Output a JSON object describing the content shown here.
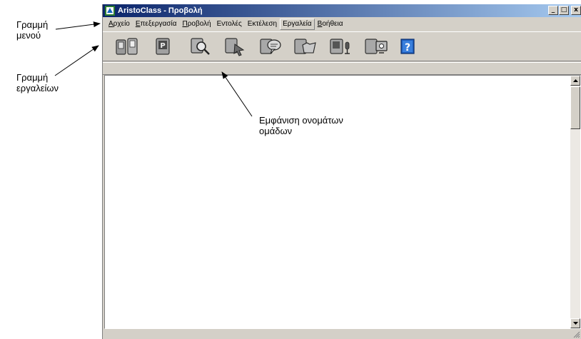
{
  "window": {
    "title": "AristoClass - Προβολή",
    "controls": [
      "_",
      "□",
      "x"
    ]
  },
  "menu": [
    {
      "label": "Αρχείο",
      "mnemonic": "Α",
      "rest": "ρχείο"
    },
    {
      "label": "Επεξεργασία",
      "mnemonic": "Ε",
      "rest": "πεξεργασία"
    },
    {
      "label": "Προβολή",
      "mnemonic": "Π",
      "rest": "ροβολή"
    },
    {
      "label": "Εντολές",
      "mnemonic": "",
      "rest": "Εντολές"
    },
    {
      "label": "Εκτέλεση",
      "mnemonic": "",
      "rest": "Εκτέλεση"
    },
    {
      "label": "Εργαλεία",
      "mnemonic": "",
      "rest": "Εργαλεία"
    },
    {
      "label": "Βοήθεια",
      "mnemonic": "Β",
      "rest": "οήθεια"
    }
  ],
  "toolbar": {
    "buttons": [
      "group-pair-icon",
      "group-settings-icon",
      "magnify-icon",
      "pointer-icon",
      "chat-icon",
      "folder-icon",
      "mic-icon",
      "screen-icon",
      "help-icon"
    ]
  },
  "callouts": {
    "menu_bar": [
      "Γραμμή",
      "μενού"
    ],
    "toolbar": [
      "Γραμμή",
      "εργαλείων"
    ],
    "group_names": [
      "Εμφάνιση ονομάτων",
      "ομάδων"
    ]
  }
}
